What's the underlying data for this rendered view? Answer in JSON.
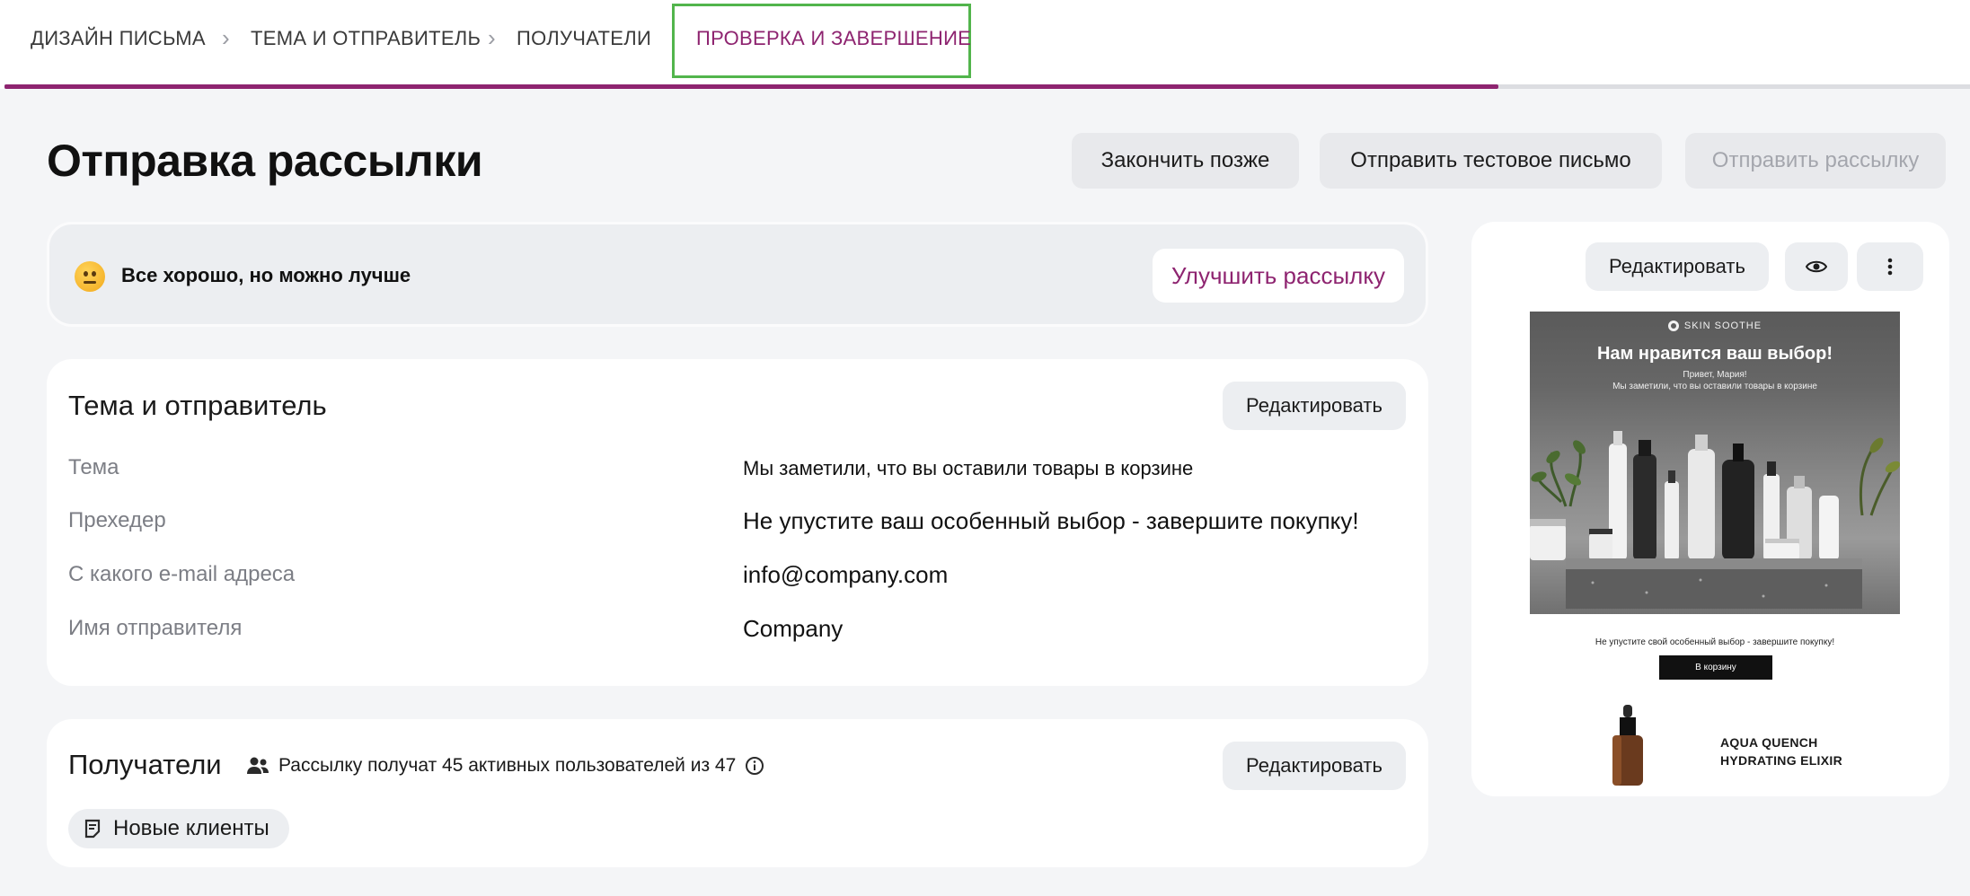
{
  "steps": {
    "items": [
      {
        "label": "ДИЗАЙН ПИСЬМА"
      },
      {
        "label": "ТЕМА И ОТПРАВИТЕЛЬ"
      },
      {
        "label": "ПОЛУЧАТЕЛИ"
      },
      {
        "label": "ПРОВЕРКА И ЗАВЕРШЕНИЕ"
      }
    ],
    "active_index": 3,
    "progress_fraction": 0.76,
    "colors": {
      "accent": "#8e2470",
      "highlight_box": "#52b54c",
      "track": "#dcdde1"
    }
  },
  "header": {
    "title": "Отправка рассылки",
    "finish_later_label": "Закончить позже",
    "send_test_label": "Отправить тестовое письмо",
    "send_label": "Отправить рассылку"
  },
  "quality": {
    "icon": "neutral-face-emoji-icon",
    "text": "Все хорошо, но можно лучше",
    "improve_label": "Улучшить рассылку"
  },
  "subject_card": {
    "title": "Тема и отправитель",
    "edit_label": "Редактировать",
    "rows": [
      {
        "label": "Тема",
        "value": "Мы заметили, что вы оставили товары в корзине"
      },
      {
        "label": "Прехедер",
        "value": "Не упустите ваш особенный выбор - завершите покупку!"
      },
      {
        "label": "С какого e-mail адреса",
        "value": "info@company.com"
      },
      {
        "label": "Имя отправителя",
        "value": "Company"
      }
    ]
  },
  "recipients_card": {
    "title": "Получатели",
    "info": "Рассылку получат 45 активных пользователей из 47",
    "edit_label": "Редактировать",
    "segment": "Новые клиенты",
    "icons": {
      "people": "people-icon",
      "info": "info-icon",
      "segment": "list-icon"
    }
  },
  "preview": {
    "edit_label": "Редактировать",
    "icons": {
      "view": "eye-icon",
      "more": "more-vertical-icon"
    },
    "email": {
      "brand": "SKIN SOOTHE",
      "heading": "Нам нравится ваш выбор!",
      "greeting": "Привет, Мария!",
      "subtext": "Мы заметили, что вы оставили товары в корзине",
      "preheader": "Не упустите свой особенный выбор - завершите покупку!",
      "cta": "В корзину",
      "product_name_line1": "AQUA QUENCH",
      "product_name_line2": "HYDRATING ELIXIR"
    }
  }
}
